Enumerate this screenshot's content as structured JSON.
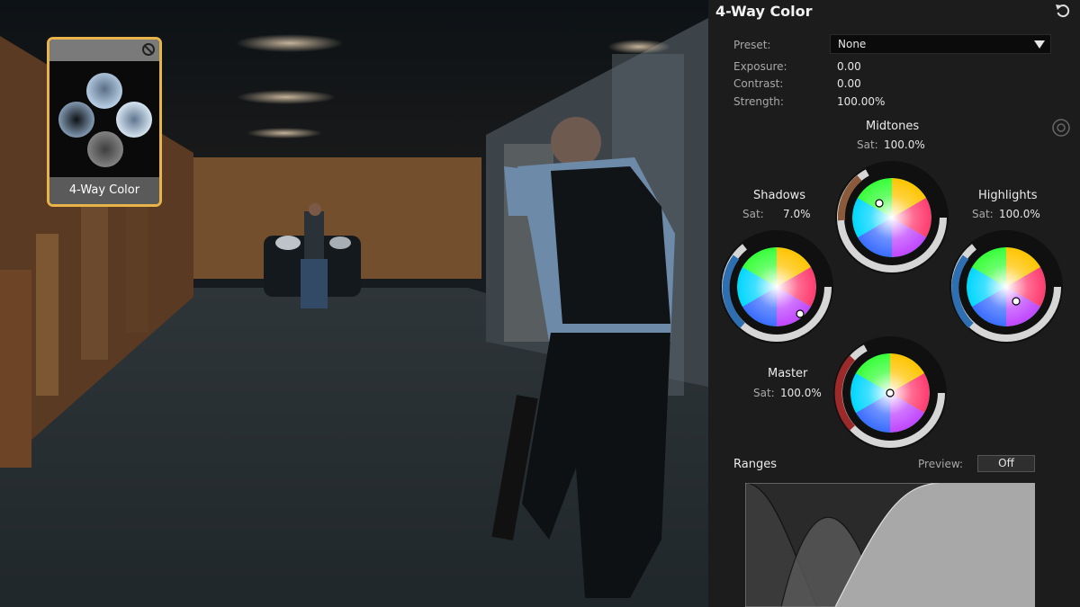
{
  "panel": {
    "title": "4-Way Color",
    "preset_label": "Preset:",
    "preset_value": "None",
    "exposure_label": "Exposure:",
    "exposure_value": "0.00",
    "contrast_label": "Contrast:",
    "contrast_value": "0.00",
    "strength_label": "Strength:",
    "strength_value": "100.00%",
    "sat_label": "Sat:",
    "ranges_label": "Ranges",
    "preview_label": "Preview:",
    "preview_value": "Off"
  },
  "wheels": {
    "midtones": {
      "name": "Midtones",
      "sat": "100.0%"
    },
    "shadows": {
      "name": "Shadows",
      "sat": "7.0%"
    },
    "highlights": {
      "name": "Highlights",
      "sat": "100.0%"
    },
    "master": {
      "name": "Master",
      "sat": "100.0%"
    }
  },
  "thumbnail": {
    "label": "4-Way Color"
  },
  "icons": {
    "reset": "reset-icon",
    "disable": "disable-icon",
    "target": "target-icon",
    "dropdown": "chevron-down-icon"
  },
  "colors": {
    "accent": "#e8b44a",
    "panel_bg": "#1c1c1c",
    "ring": "#d8d8d8"
  }
}
